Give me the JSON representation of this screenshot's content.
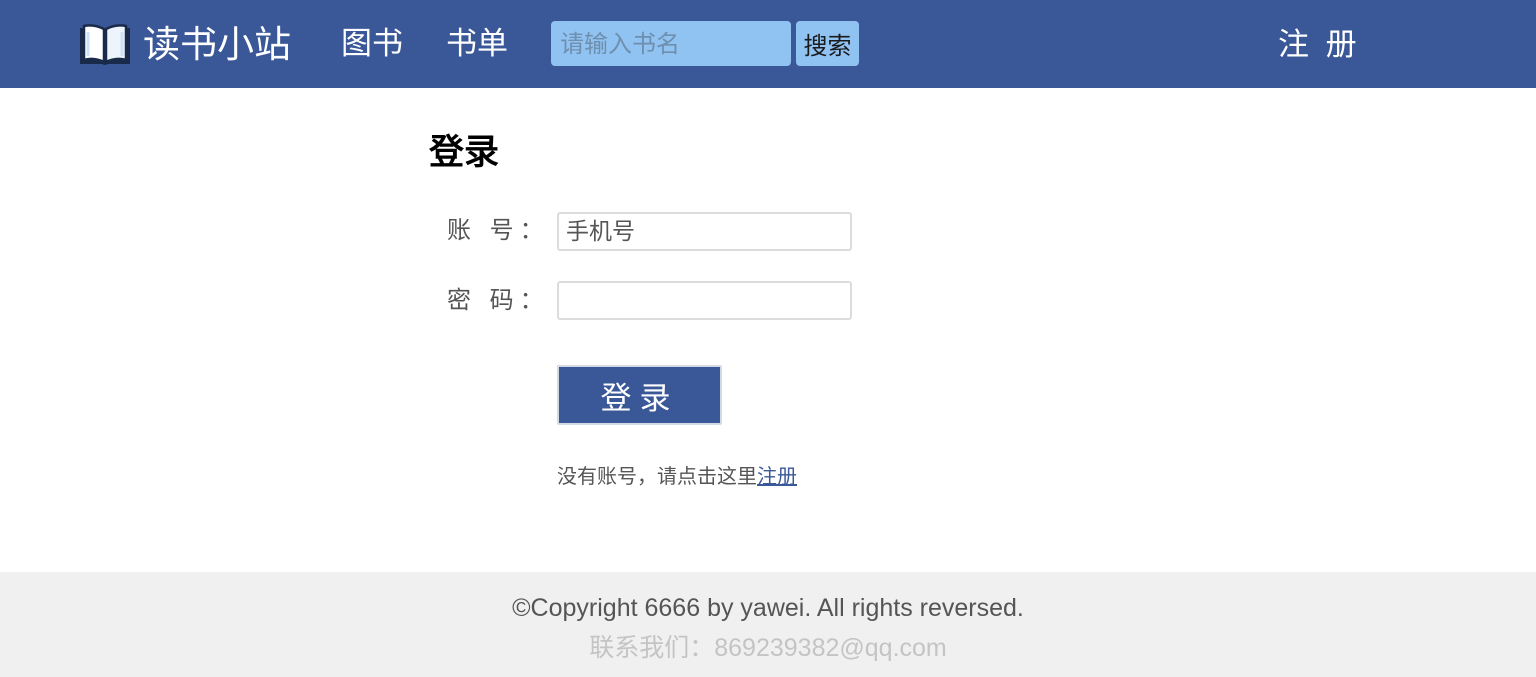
{
  "header": {
    "site_name": "读书小站",
    "nav": {
      "books": "图书",
      "book_lists": "书单"
    },
    "search": {
      "placeholder": "请输入书名",
      "button": "搜索"
    },
    "register": "注 册"
  },
  "login": {
    "title": "登录",
    "account_label": "账 号：",
    "account_placeholder": "手机号",
    "password_label": "密 码：",
    "submit": "登录",
    "hint_prefix": "没有账号，请点击这里",
    "hint_link": "注册"
  },
  "footer": {
    "copyright": "©Copyright 6666 by yawei. All rights reversed.",
    "contact": "联系我们：869239382@qq.com"
  },
  "colors": {
    "header_bg": "#3a5898",
    "search_bg": "#90c2f2",
    "button_bg": "#3a5898",
    "footer_bg": "#f0f0f0"
  },
  "icons": {
    "logo": "open-book-icon"
  }
}
